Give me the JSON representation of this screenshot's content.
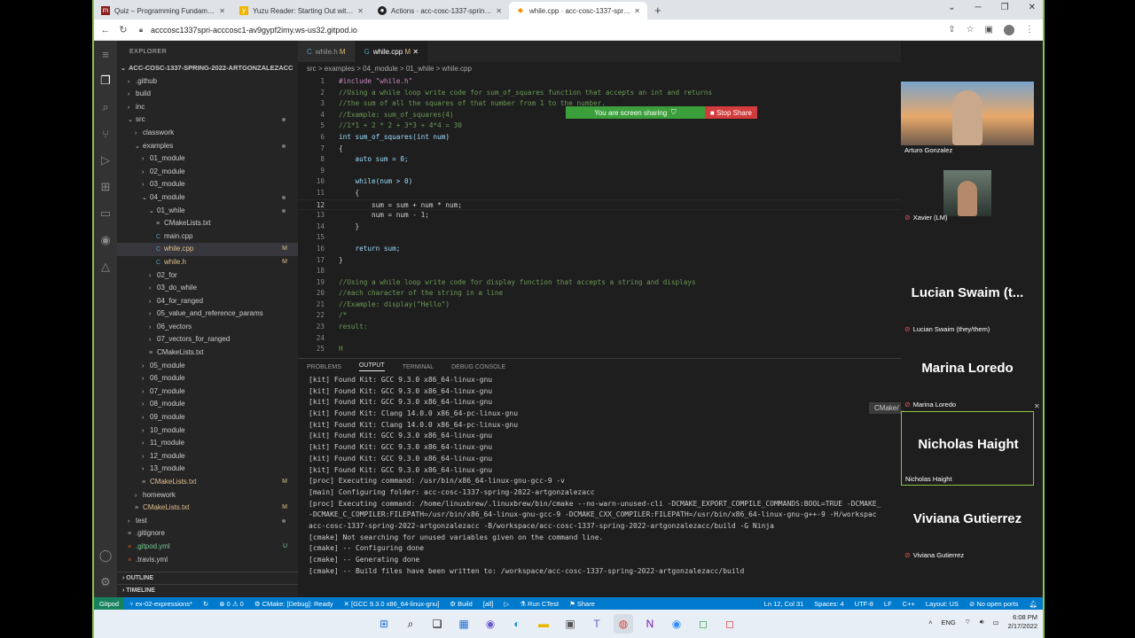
{
  "browser": {
    "tabs": [
      {
        "title": "Quiz – Programming Fundamentals",
        "icon": "mc-icon",
        "active": false
      },
      {
        "title": "Yuzu Reader: Starting Out with P",
        "icon": "bookmark-icon",
        "active": false
      },
      {
        "title": "Actions · acc-cosc-1337-spring-2022",
        "icon": "github-icon",
        "active": false
      },
      {
        "title": "while.cpp · acc-cosc-1337-spring",
        "icon": "gitpod-icon",
        "active": true
      }
    ],
    "new_tab": "+",
    "url": "acccosc1337spri-acccosc1-av9gypf2imy.ws-us32.gitpod.io"
  },
  "explorer": {
    "title": "EXPLORER",
    "root": "ACC-COSC-1337-SPRING-2022-ARTGONZALEZACC",
    "items": [
      {
        "label": ".github",
        "depth": 1,
        "type": "folder",
        "open": false
      },
      {
        "label": "build",
        "depth": 1,
        "type": "folder",
        "open": false
      },
      {
        "label": "inc",
        "depth": 1,
        "type": "folder",
        "open": false
      },
      {
        "label": "src",
        "depth": 1,
        "type": "folder",
        "open": true,
        "dot": true
      },
      {
        "label": "classwork",
        "depth": 2,
        "type": "folder",
        "open": false
      },
      {
        "label": "examples",
        "depth": 2,
        "type": "folder",
        "open": true,
        "dot": true
      },
      {
        "label": "01_module",
        "depth": 3,
        "type": "folder",
        "open": false
      },
      {
        "label": "02_module",
        "depth": 3,
        "type": "folder",
        "open": false
      },
      {
        "label": "03_module",
        "depth": 3,
        "type": "folder",
        "open": false
      },
      {
        "label": "04_module",
        "depth": 3,
        "type": "folder",
        "open": true,
        "dot": true
      },
      {
        "label": "01_while",
        "depth": 4,
        "type": "folder",
        "open": true,
        "dot": true
      },
      {
        "label": "CMakeLists.txt",
        "depth": 5,
        "type": "file"
      },
      {
        "label": "main.cpp",
        "depth": 5,
        "type": "file"
      },
      {
        "label": "while.cpp",
        "depth": 5,
        "type": "file",
        "mark": "M",
        "selected": true
      },
      {
        "label": "while.h",
        "depth": 5,
        "type": "file",
        "mark": "M"
      },
      {
        "label": "02_for",
        "depth": 4,
        "type": "folder",
        "open": false
      },
      {
        "label": "03_do_while",
        "depth": 4,
        "type": "folder",
        "open": false
      },
      {
        "label": "04_for_ranged",
        "depth": 4,
        "type": "folder",
        "open": false
      },
      {
        "label": "05_value_and_reference_params",
        "depth": 4,
        "type": "folder",
        "open": false
      },
      {
        "label": "06_vectors",
        "depth": 4,
        "type": "folder",
        "open": false
      },
      {
        "label": "07_vectors_for_ranged",
        "depth": 4,
        "type": "folder",
        "open": false
      },
      {
        "label": "CMakeLists.txt",
        "depth": 4,
        "type": "file"
      },
      {
        "label": "05_module",
        "depth": 3,
        "type": "folder",
        "open": false
      },
      {
        "label": "06_module",
        "depth": 3,
        "type": "folder",
        "open": false
      },
      {
        "label": "07_module",
        "depth": 3,
        "type": "folder",
        "open": false
      },
      {
        "label": "08_module",
        "depth": 3,
        "type": "folder",
        "open": false
      },
      {
        "label": "09_module",
        "depth": 3,
        "type": "folder",
        "open": false
      },
      {
        "label": "10_module",
        "depth": 3,
        "type": "folder",
        "open": false
      },
      {
        "label": "11_module",
        "depth": 3,
        "type": "folder",
        "open": false
      },
      {
        "label": "12_module",
        "depth": 3,
        "type": "folder",
        "open": false
      },
      {
        "label": "13_module",
        "depth": 3,
        "type": "folder",
        "open": false
      },
      {
        "label": "CMakeLists.txt",
        "depth": 3,
        "type": "file",
        "mark": "M"
      },
      {
        "label": "homework",
        "depth": 2,
        "type": "folder",
        "open": false
      },
      {
        "label": "CMakeLists.txt",
        "depth": 2,
        "type": "file",
        "mark": "M"
      },
      {
        "label": "test",
        "depth": 1,
        "type": "folder",
        "open": false,
        "dot": true
      },
      {
        "label": ".gitignore",
        "depth": 1,
        "type": "file"
      },
      {
        "label": ".gitpod.yml",
        "depth": 1,
        "type": "file",
        "mark": "U"
      },
      {
        "label": ".travis.yml",
        "depth": 1,
        "type": "file"
      }
    ],
    "outline": "OUTLINE",
    "timeline": "TIMELINE"
  },
  "editor": {
    "tabs": [
      {
        "label": "while.h",
        "mark": "M",
        "active": false
      },
      {
        "label": "while.cpp",
        "mark": "M",
        "active": true
      }
    ],
    "breadcrumb": "src > examples > 04_module > 01_while > while.cpp",
    "lines": [
      "#include \"while.h\"",
      "//Using a while loop write code for sum_of_squares function that accepts an int and returns",
      "//the sum of all the squares of that number from 1 to the number.",
      "//Example: sum_of_squares(4)",
      "//1*1 + 2 * 2 + 3*3 + 4*4 = 30",
      "int sum_of_squares(int num)",
      "{",
      "    auto sum = 0;",
      "",
      "    while(num > 0)",
      "    {",
      "        sum = sum + num * num;",
      "        num = num - 1;",
      "    }",
      "",
      "    return sum;",
      "}",
      "",
      "//Using a while loop write code for display function that accepts a string and displays",
      "//each character of the string in a line",
      "//Example: display(\"Hello\")",
      "/*",
      "result:",
      "",
      "H"
    ],
    "current_line": 12
  },
  "sharing": {
    "text": "You are screen sharing",
    "stop": "Stop Share"
  },
  "panel": {
    "tabs": [
      "PROBLEMS",
      "OUTPUT",
      "TERMINAL",
      "DEBUG CONSOLE"
    ],
    "active_tab": "OUTPUT",
    "channel": "CMake/",
    "lines": [
      "[kit] Found Kit: GCC 9.3.0 x86_64-linux-gnu",
      "[kit] Found Kit: GCC 9.3.0 x86_64-linux-gnu",
      "[kit] Found Kit: GCC 9.3.0 x86_64-linux-gnu",
      "[kit] Found Kit: Clang 14.0.0 x86_64-pc-linux-gnu",
      "[kit] Found Kit: Clang 14.0.0 x86_64-pc-linux-gnu",
      "[kit] Found Kit: GCC 9.3.0 x86_64-linux-gnu",
      "[kit] Found Kit: GCC 9.3.0 x86_64-linux-gnu",
      "[kit] Found Kit: GCC 9.3.0 x86_64-linux-gnu",
      "[kit] Found Kit: GCC 9.3.0 x86_64-linux-gnu",
      "[proc] Executing command: /usr/bin/x86_64-linux-gnu-gcc-9 -v",
      "[main] Configuring folder: acc-cosc-1337-spring-2022-artgonzalezacc",
      "[proc] Executing command: /home/linuxbrew/.linuxbrew/bin/cmake --no-warn-unused-cli -DCMAKE_EXPORT_COMPILE_COMMANDS:BOOL=TRUE -DCMAKE_",
      "-DCMAKE_C_COMPILER:FILEPATH=/usr/bin/x86_64-linux-gnu-gcc-9 -DCMAKE_CXX_COMPILER:FILEPATH=/usr/bin/x86_64-linux-gnu-g++-9 -H/workspac",
      "acc-cosc-1337-spring-2022-artgonzalezacc -B/workspace/acc-cosc-1337-spring-2022-artgonzalezacc/build -G Ninja",
      "[cmake] Not searching for unused variables given on the command line.",
      "[cmake] -- Configuring done",
      "[cmake] -- Generating done",
      "[cmake] -- Build files have been written to: /workspace/acc-cosc-1337-spring-2022-artgonzalezacc/build"
    ]
  },
  "participants": [
    {
      "name": "Arturo Gonzalez",
      "video": true,
      "muted": false
    },
    {
      "name": "Xavier (LM)",
      "video": true,
      "muted": true
    },
    {
      "name": "Lucian Swaim (they/them)",
      "display": "Lucian Swaim (t...",
      "muted": true
    },
    {
      "name": "Marina Loredo",
      "display": "Marina Loredo",
      "muted": true
    },
    {
      "name": "Nicholas Haight",
      "display": "Nicholas Haight",
      "muted": false
    },
    {
      "name": "Viviana Gutierrez",
      "display": "Viviana Gutierrez",
      "muted": true
    }
  ],
  "statusbar": {
    "gitpod": "Gitpod",
    "branch": "ex-02-expressions*",
    "errors": "⊗ 0 ⚠ 0",
    "cmake": "CMake: [Debug]: Ready",
    "kit": "[GCC 9.3.0 x86_64-linux-gnu]",
    "build": "Build",
    "target": "[all]",
    "ctest": "Run CTest",
    "share": "Share",
    "position": "Ln 12, Col 31",
    "spaces": "Spaces: 4",
    "encoding": "UTF-8",
    "eol": "LF",
    "lang": "C++",
    "layout": "Layout: US",
    "ports": "No open ports"
  },
  "taskbar": {
    "lang": "ENG",
    "time": "6:08 PM",
    "date": "2/17/2022"
  },
  "colors": {
    "accent": "#007acc",
    "gitpod": "#16825d",
    "share_green": "#3b9f3b",
    "share_red": "#d23c3c",
    "frame": "#8cc63f"
  }
}
